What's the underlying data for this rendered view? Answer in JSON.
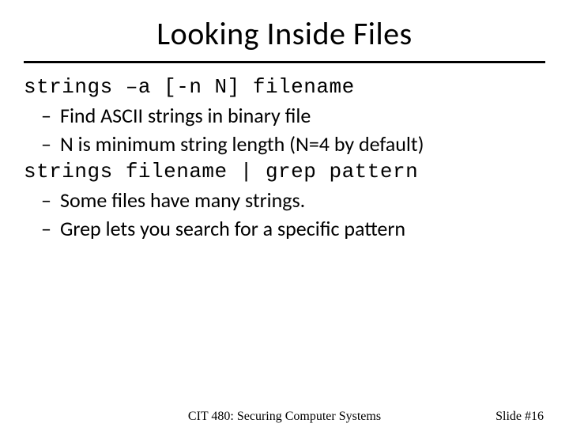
{
  "title": "Looking Inside Files",
  "section1": {
    "command": "strings –a [-n N] filename",
    "bullets": [
      "Find ASCII strings in binary file",
      "N is minimum string length (N=4 by default)"
    ]
  },
  "section2": {
    "command": "strings filename | grep pattern",
    "bullets": [
      "Some files have many strings.",
      "Grep lets you search for a specific pattern"
    ]
  },
  "footer": {
    "center": "CIT 480: Securing Computer Systems",
    "right": "Slide #16"
  }
}
